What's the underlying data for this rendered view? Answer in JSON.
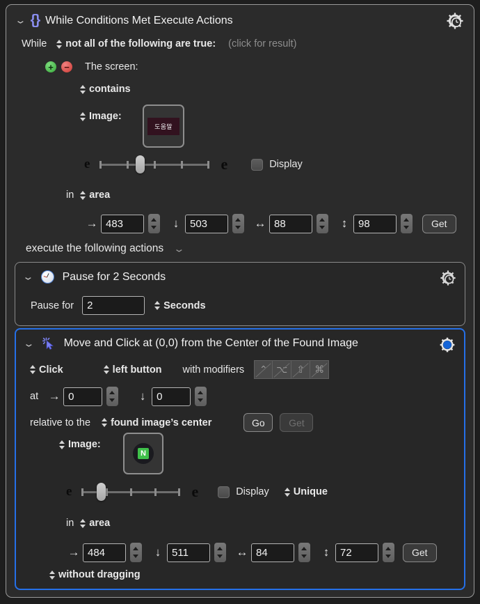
{
  "window": {
    "action_title": "While Conditions Met Execute Actions",
    "braces_icon": "braces-icon",
    "gear_clock_icon": "gear-clock-icon"
  },
  "condition": {
    "while_label": "While",
    "match_mode": "not all of the following are true:",
    "result_hint": "(click for result)",
    "add_button": "+",
    "delete_button": "−",
    "source_label": "The screen:",
    "operator": "contains",
    "image_label": "Image:",
    "thumbnail_text": "도움말",
    "fuzz_left": "e",
    "fuzz_right": "e",
    "display_label": "Display",
    "display_checked": false,
    "area_prefix": "in",
    "area_label": "area",
    "coords": [
      {
        "glyph": "→",
        "name": "left",
        "value": "483"
      },
      {
        "glyph": "↓",
        "name": "top",
        "value": "503"
      },
      {
        "glyph": "↔",
        "name": "width",
        "value": "88"
      },
      {
        "glyph": "↕",
        "name": "height",
        "value": "98"
      }
    ],
    "get_button": "Get"
  },
  "actions_section": {
    "label": "execute the following actions",
    "chevron": "chevron-down-icon"
  },
  "pause_action": {
    "title": "Pause for 2 Seconds",
    "clock_icon": "clock-icon",
    "gear_icon": "gear-clock-icon",
    "pause_for_label": "Pause for",
    "duration": "2",
    "unit": "Seconds"
  },
  "click_action": {
    "title": "Move and Click at (0,0) from the Center of the Found Image",
    "cursor_icon": "click-cursor-icon",
    "gear_icon": "gear-blue-icon",
    "click_mode": "Click",
    "button_mode": "left button",
    "modifiers_label": "with modifiers",
    "modifier_keys": [
      {
        "name": "control",
        "glyph": "⌃"
      },
      {
        "name": "option",
        "glyph": "⌥"
      },
      {
        "name": "shift",
        "glyph": "⇧"
      },
      {
        "name": "command",
        "glyph": "⌘"
      }
    ],
    "at_label": "at",
    "at_coords": [
      {
        "glyph": "→",
        "name": "x-offset",
        "value": "0"
      },
      {
        "glyph": "↓",
        "name": "y-offset",
        "value": "0"
      }
    ],
    "relative_label": "relative to the",
    "relative_target": "found image’s center",
    "go_button": "Go",
    "get_button_top": "Get",
    "image_label": "Image:",
    "thumbnail_letter": "N",
    "fuzz_left": "e",
    "fuzz_right": "e",
    "display_label": "Display",
    "display_checked": false,
    "uniqueness": "Unique",
    "area_prefix": "in",
    "area_label": "area",
    "coords": [
      {
        "glyph": "→",
        "name": "left",
        "value": "484"
      },
      {
        "glyph": "↓",
        "name": "top",
        "value": "511"
      },
      {
        "glyph": "↔",
        "name": "width",
        "value": "84"
      },
      {
        "glyph": "↕",
        "name": "height",
        "value": "72"
      }
    ],
    "get_button": "Get",
    "drag_mode": "without dragging"
  },
  "colors": {
    "selection_blue": "#2570e8",
    "accent_purple": "#8a8ef0",
    "add_green": "#37a83a",
    "delete_red": "#cc3b33",
    "thumb_maroon": "#32121f",
    "naver_green": "#3fc04a"
  }
}
